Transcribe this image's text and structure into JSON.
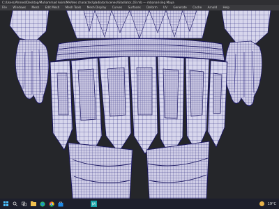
{
  "app": {
    "title_path": "C:/Users/Ahmed/Desktop/Muhammad Asim/MH/des character/gladiator/scenes/Gladiator_03.mb  ---  mbanarising Maya"
  },
  "menubar": {
    "items": [
      "File",
      "Windows",
      "Mesh",
      "Edit Mesh",
      "Mesh Tools",
      "Mesh Display",
      "Curves",
      "Surfaces",
      "Deform",
      "UV",
      "Generate",
      "Cache",
      "Arnold",
      "Help"
    ]
  },
  "viewport": {
    "background_color": "#25262a",
    "mesh_fill_color": "#d7d6ec",
    "wire_color": "#26227a",
    "subject": "wireframe-character-armor"
  },
  "taskbar": {
    "background_color": "#1d1f2c",
    "icons": [
      "windows-start-icon",
      "search-icon",
      "task-view-icon",
      "file-explorer-icon",
      "edge-browser-icon",
      "chrome-icon",
      "maya-app-icon",
      "store-icon"
    ],
    "weather": "19°C"
  }
}
